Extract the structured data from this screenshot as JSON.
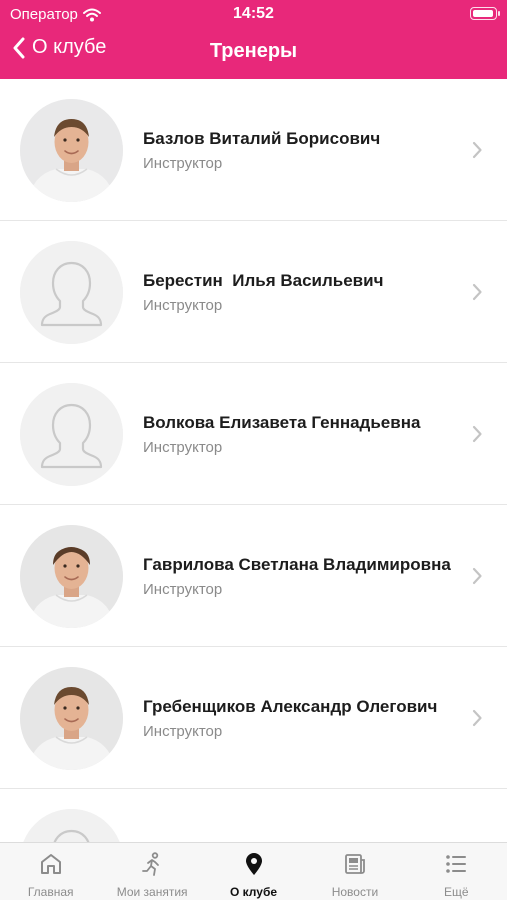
{
  "status_bar": {
    "carrier": "Оператор",
    "time": "14:52"
  },
  "nav": {
    "back_label": "О клубе",
    "title": "Тренеры"
  },
  "trainers": [
    {
      "name": "Базлов Виталий Борисович",
      "role": "Инструктор",
      "avatar": "photo"
    },
    {
      "name": "Берестин  Илья Васильевич",
      "role": "Инструктор",
      "avatar": "placeholder"
    },
    {
      "name": "Волкова Елизавета Геннадьевна",
      "role": "Инструктор",
      "avatar": "placeholder"
    },
    {
      "name": "Гаврилова Светлана Владимировна",
      "role": "Инструктор",
      "avatar": "photo"
    },
    {
      "name": "Гребенщиков Александр Олегович",
      "role": "Инструктор",
      "avatar": "photo"
    },
    {
      "name": "",
      "role": "",
      "avatar": "placeholder"
    }
  ],
  "tabs": [
    {
      "label": "Главная",
      "icon": "home-icon",
      "active": false
    },
    {
      "label": "Мои занятия",
      "icon": "runner-icon",
      "active": false
    },
    {
      "label": "О клубе",
      "icon": "location-pin-icon",
      "active": true
    },
    {
      "label": "Новости",
      "icon": "newspaper-icon",
      "active": false
    },
    {
      "label": "Ещё",
      "icon": "more-list-icon",
      "active": false
    }
  ],
  "colors": {
    "accent": "#e8287a",
    "tab_active": "#111111",
    "tab_inactive": "#8c8c8c"
  }
}
